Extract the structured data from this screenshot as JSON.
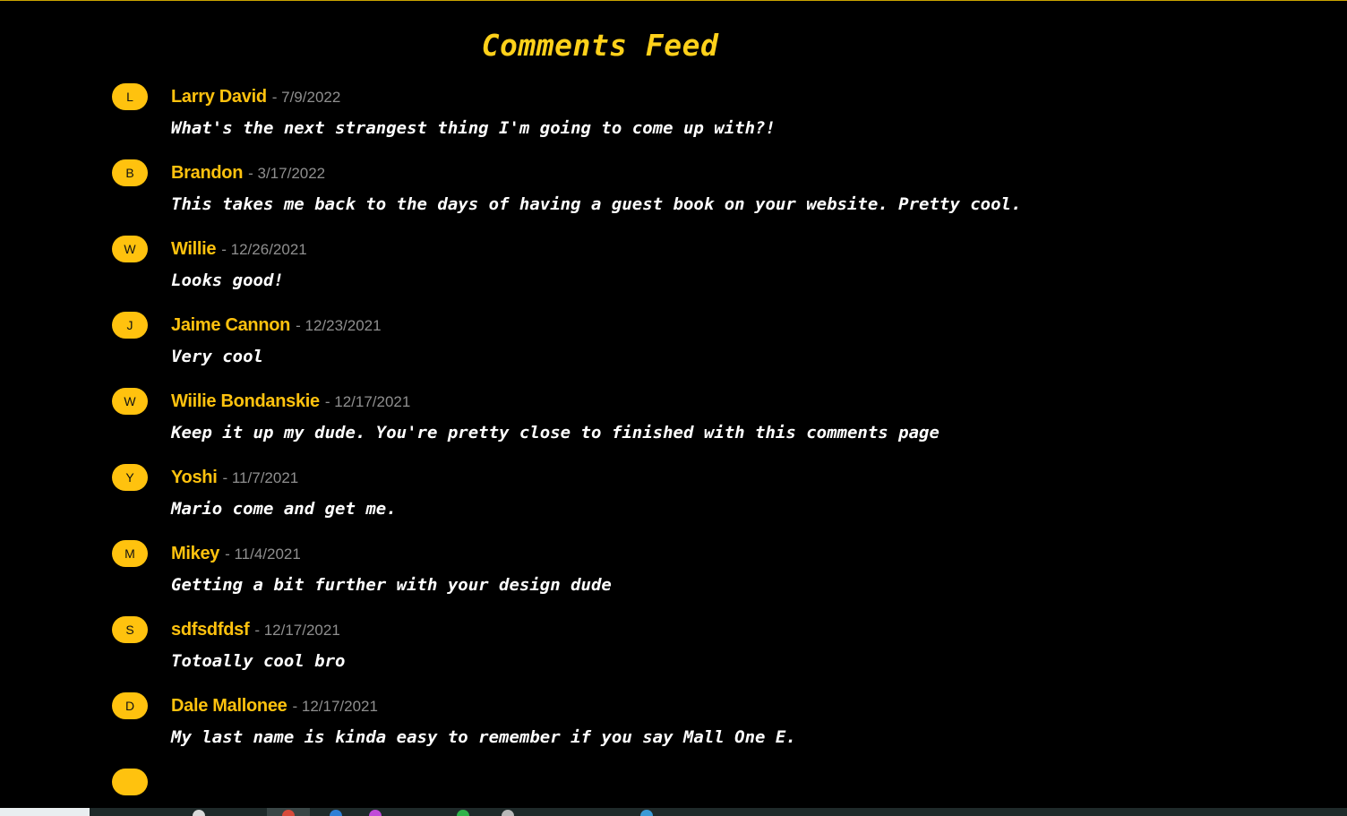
{
  "header": {
    "title": "Comments Feed"
  },
  "comments": [
    {
      "initial": "L",
      "author": "Larry David",
      "date": "- 7/9/2022",
      "text": "What's the next strangest thing I'm going to come up with?!"
    },
    {
      "initial": "B",
      "author": "Brandon",
      "date": "- 3/17/2022",
      "text": "This takes me back to the days of having a guest book on your website. Pretty cool."
    },
    {
      "initial": "W",
      "author": "Willie",
      "date": "- 12/26/2021",
      "text": "Looks good!"
    },
    {
      "initial": "J",
      "author": "Jaime Cannon",
      "date": "- 12/23/2021",
      "text": "Very cool"
    },
    {
      "initial": "W",
      "author": "Wiilie Bondanskie",
      "date": "- 12/17/2021",
      "text": "Keep it up my dude. You're pretty close to finished with this comments page"
    },
    {
      "initial": "Y",
      "author": "Yoshi",
      "date": "- 11/7/2021",
      "text": "Mario come and get me."
    },
    {
      "initial": "M",
      "author": "Mikey",
      "date": "- 11/4/2021",
      "text": "Getting a bit further with your design dude"
    },
    {
      "initial": "S",
      "author": "sdfsdfdsf",
      "date": "- 12/17/2021",
      "text": "Totoally cool bro"
    },
    {
      "initial": "D",
      "author": "Dale Mallonee",
      "date": "- 12/17/2021",
      "text": "My last name is kinda easy to remember if you say Mall One E."
    }
  ],
  "colors": {
    "background": "#000000",
    "accent": "#ffc20e",
    "title": "#ffd11a",
    "date": "#8f8f8f",
    "text": "#ffffff"
  },
  "taskbar": {
    "icons": [
      "start-button-icon",
      "file-explorer-icon",
      "chrome-icon",
      "edge-icon",
      "app-icon",
      "app-icon",
      "app-icon"
    ]
  }
}
